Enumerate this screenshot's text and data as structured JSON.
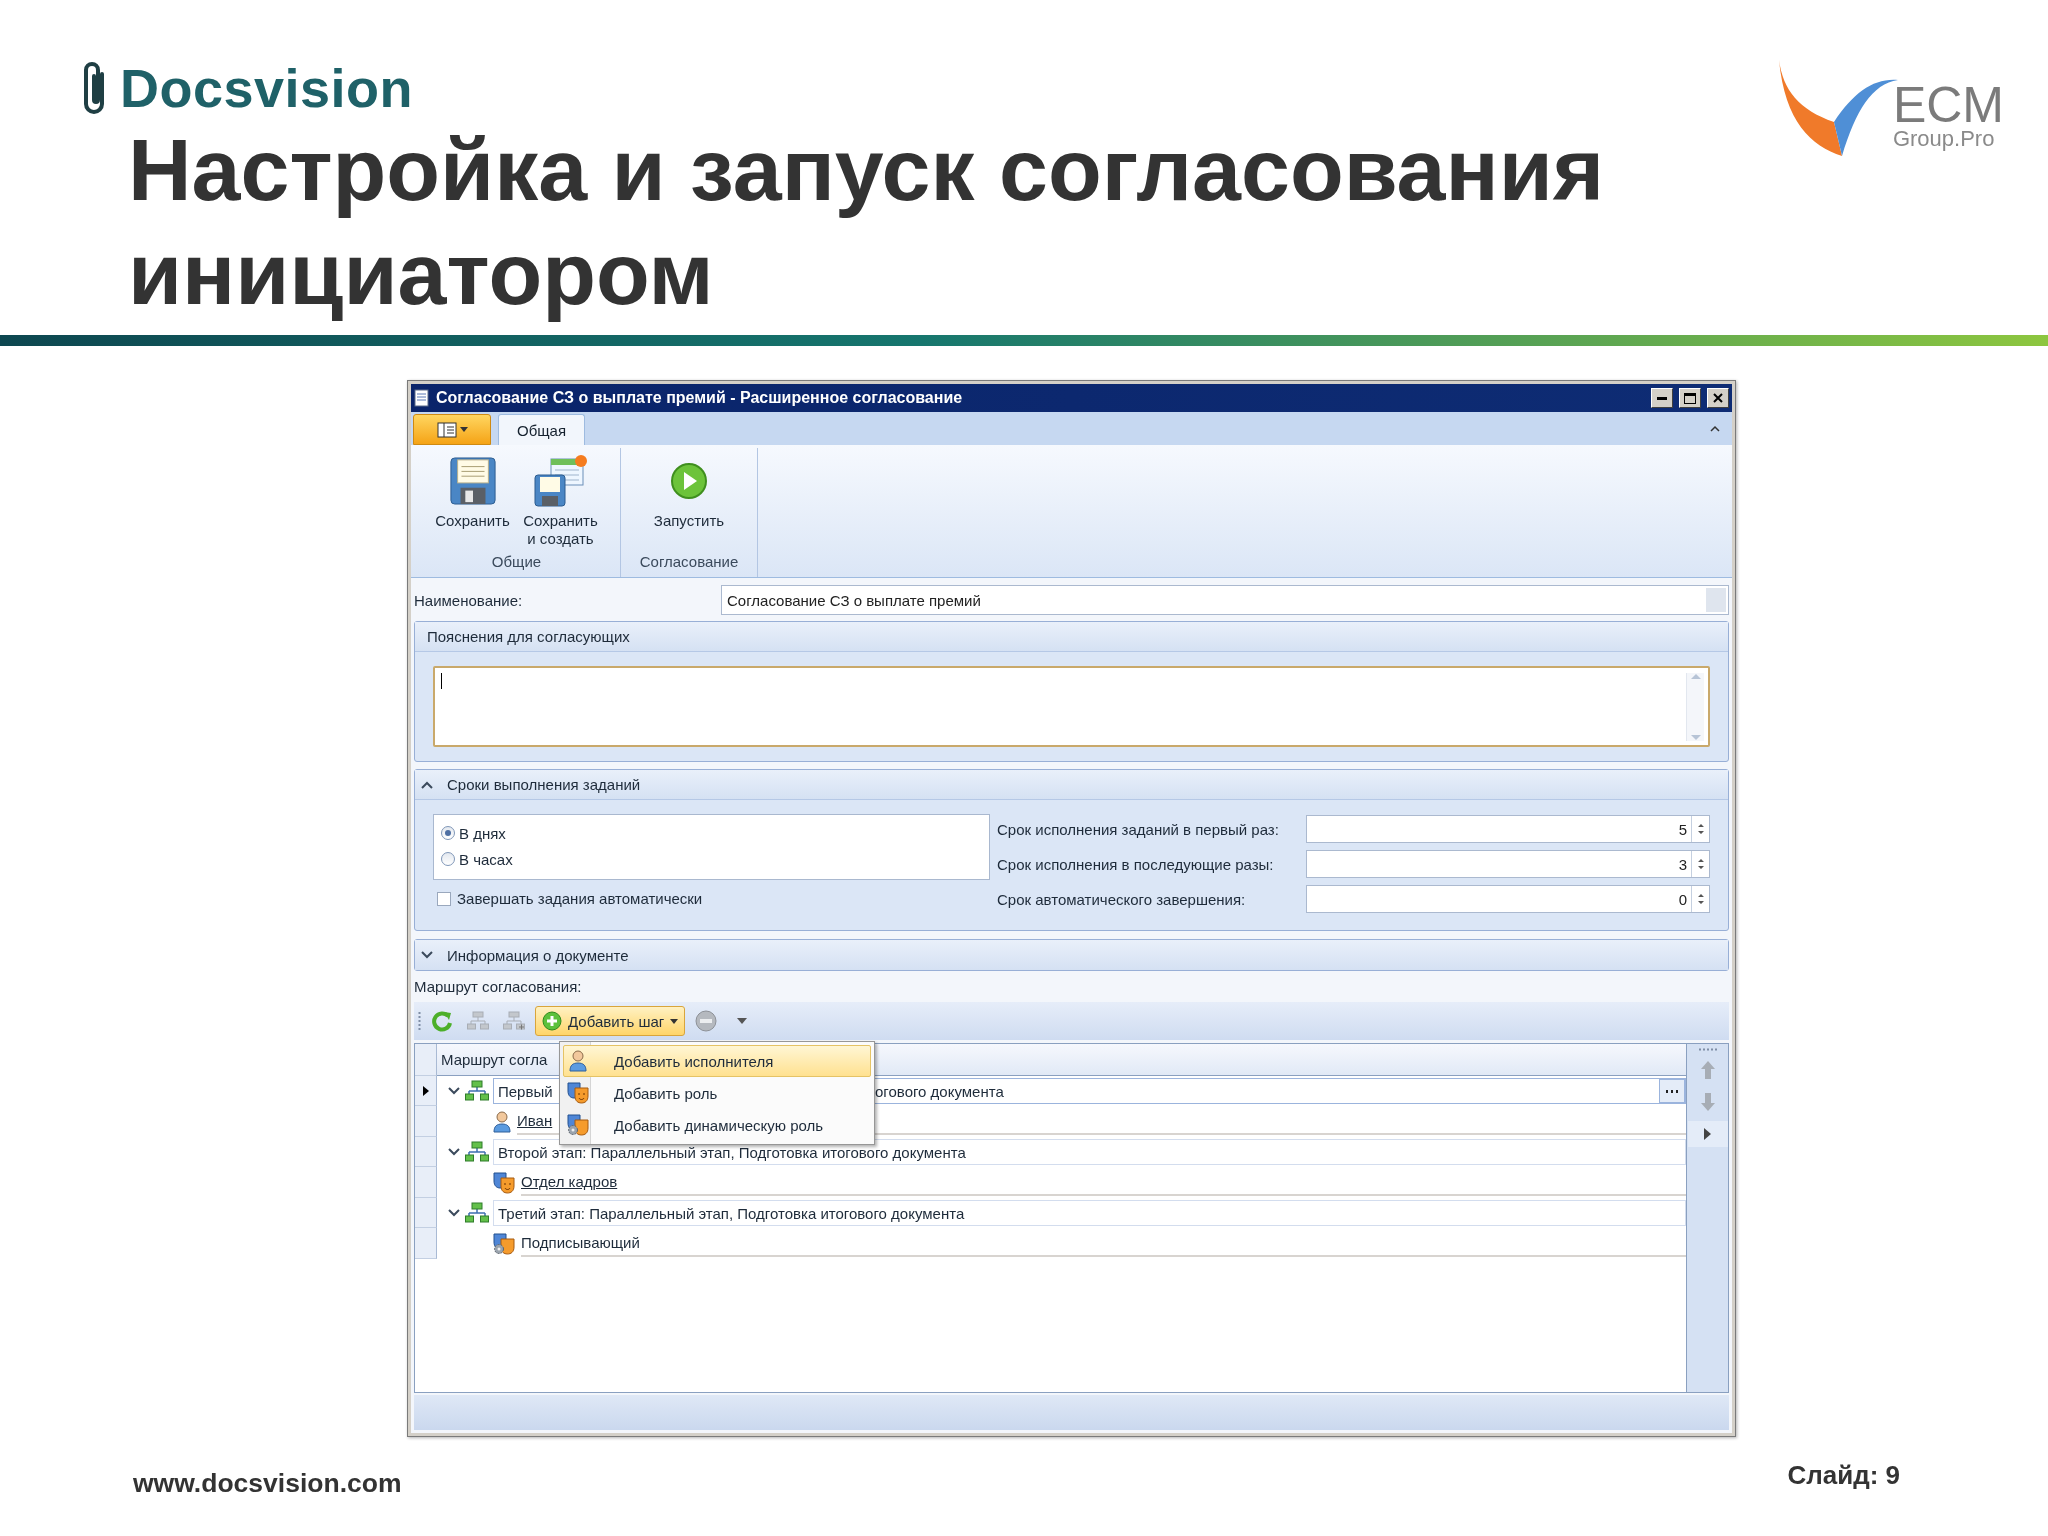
{
  "slide": {
    "brand": "Docsvision",
    "title_lines": [
      "Настройка и запуск согласования",
      "инициатором"
    ],
    "partner": {
      "name": "ECM",
      "tagline": "Group.Pro"
    },
    "footer_url": "www.docsvision.com",
    "slide_number": "Слайд: 9"
  },
  "window": {
    "title": "Согласование СЗ о выплате премий - Расширенное согласование"
  },
  "ribbon": {
    "tabs": [
      {
        "label": "Общая",
        "selected": true
      }
    ],
    "groups": [
      {
        "label": "Общие",
        "buttons": [
          {
            "kind": "save",
            "label": "Сохранить"
          },
          {
            "kind": "save-new",
            "label": "Сохранить и создать"
          }
        ]
      },
      {
        "label": "Согласование",
        "buttons": [
          {
            "kind": "run",
            "label": "Запустить"
          }
        ]
      }
    ]
  },
  "name_field": {
    "label": "Наименование:",
    "value": "Согласование СЗ о выплате премий"
  },
  "notes_panel": {
    "title": "Пояснения для согласующих"
  },
  "deadlines_panel": {
    "title": "Сроки выполнения заданий",
    "expanded": true,
    "units": [
      {
        "label": "В днях",
        "selected": true
      },
      {
        "label": "В часах",
        "selected": false
      }
    ],
    "auto_complete": {
      "label": "Завершать задания автоматически",
      "checked": false
    },
    "fields": [
      {
        "label": "Срок исполнения заданий в первый раз:",
        "value": "5"
      },
      {
        "label": "Срок исполнения в последующие разы:",
        "value": "3"
      },
      {
        "label": "Срок автоматического завершения:",
        "value": "0"
      }
    ]
  },
  "info_panel": {
    "title": "Информация о документе",
    "expanded": false
  },
  "route": {
    "label": "Маршрут согласования:",
    "tools": [
      {
        "kind": "refresh",
        "disabled": false
      },
      {
        "kind": "add-level",
        "disabled": true
      },
      {
        "kind": "add-sublevel",
        "disabled": true
      },
      {
        "kind": "add-step",
        "label": "Добавить шаг",
        "expanded": true
      },
      {
        "kind": "remove",
        "disabled": true
      },
      {
        "kind": "more"
      }
    ],
    "menu": [
      {
        "kind": "person",
        "label": "Добавить исполнителя",
        "selected": true
      },
      {
        "kind": "role",
        "label": "Добавить роль",
        "selected": false
      },
      {
        "kind": "dynamic-role",
        "label": "Добавить динамическую роль",
        "selected": false
      }
    ],
    "column": "Маршрут согла",
    "stages": [
      {
        "text_parts": [
          "Первый",
          "огового документа"
        ],
        "expanded": true,
        "selected": true,
        "children": [
          {
            "kind": "person",
            "text": "Иван",
            "linked": true
          }
        ]
      },
      {
        "text_parts": [
          "Второй этап: Параллельный этап, Подготовка итогового документа"
        ],
        "expanded": true,
        "selected": false,
        "children": [
          {
            "kind": "role",
            "text": "Отдел кадров",
            "linked": true
          }
        ]
      },
      {
        "text_parts": [
          "Третий этап: Параллельный этап, Подготовка итогового документа"
        ],
        "expanded": true,
        "selected": false,
        "children": [
          {
            "kind": "dynamic-role",
            "text": "Подписывающий",
            "linked": false
          }
        ]
      }
    ]
  }
}
